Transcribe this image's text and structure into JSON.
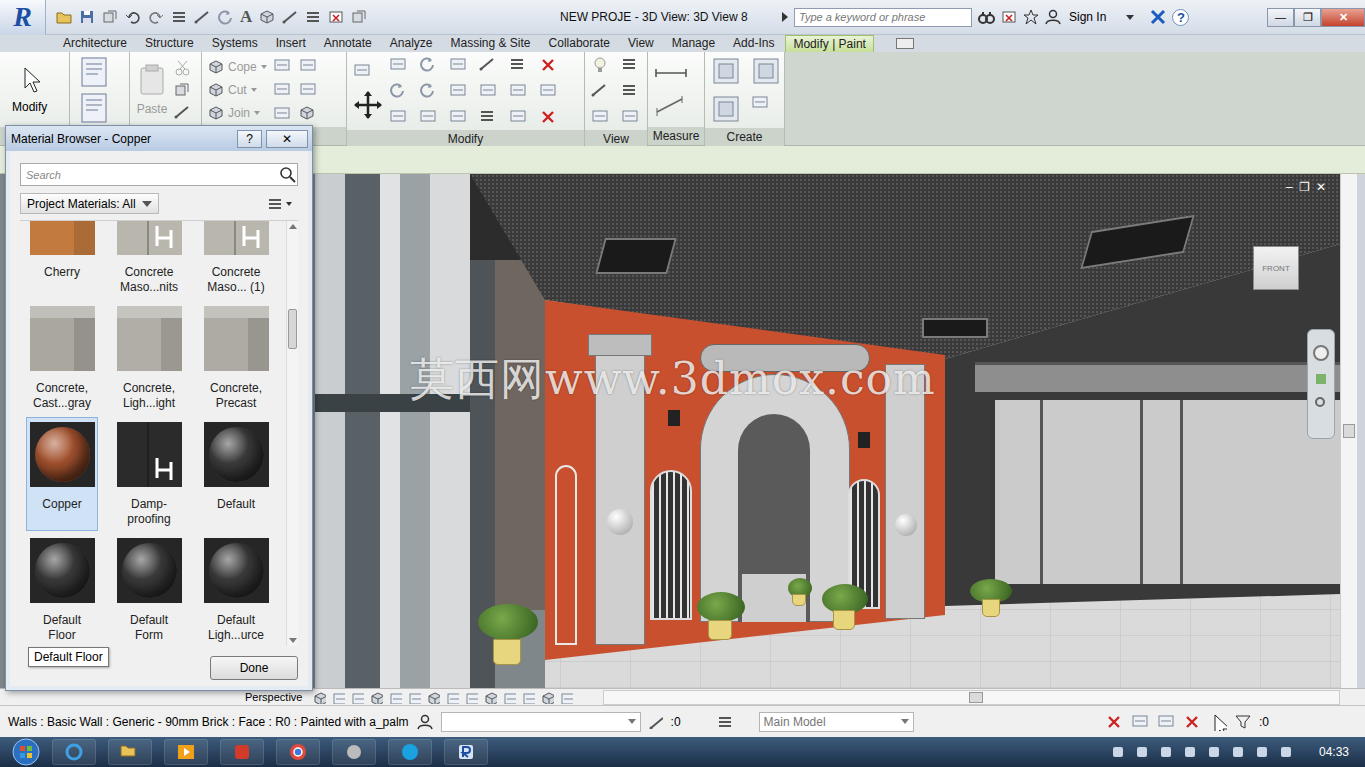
{
  "window": {
    "title": "NEW PROJE - 3D View: 3D View 8",
    "app_button": "R",
    "controls": [
      "—",
      "❐",
      "✕"
    ]
  },
  "quick_access": {
    "text_tool": "A"
  },
  "help_search": {
    "placeholder": "Type a keyword or phrase",
    "sign_in": "Sign In",
    "help": "?"
  },
  "ribbon_tabs": [
    {
      "label": "Architecture",
      "selected": false
    },
    {
      "label": "Structure",
      "selected": false
    },
    {
      "label": "Systems",
      "selected": false
    },
    {
      "label": "Insert",
      "selected": false
    },
    {
      "label": "Annotate",
      "selected": false
    },
    {
      "label": "Analyze",
      "selected": false
    },
    {
      "label": "Massing & Site",
      "selected": false
    },
    {
      "label": "Collaborate",
      "selected": false
    },
    {
      "label": "View",
      "selected": false
    },
    {
      "label": "Manage",
      "selected": false
    },
    {
      "label": "Add-Ins",
      "selected": false
    },
    {
      "label": "Modify | Paint",
      "selected": true
    }
  ],
  "ribbon": {
    "modify_button": "Modify",
    "paste": "Paste",
    "geometry": [
      {
        "label": "Cope",
        "disabled": true
      },
      {
        "label": "Cut",
        "disabled": true
      },
      {
        "label": "Join",
        "disabled": true
      }
    ],
    "panels": [
      {
        "label": "Modify"
      },
      {
        "label": "View"
      },
      {
        "label": "Measure"
      },
      {
        "label": "Create"
      }
    ]
  },
  "viewport": {
    "watermark": "莫西网www.3dmox.com",
    "viewcube_face": "FRONT",
    "controls": [
      "–",
      "❐",
      "✕"
    ]
  },
  "view_control_bar": {
    "scale": "Perspective"
  },
  "status_bar": {
    "message": "Walls : Basic Wall : Generic - 90mm Brick : Face : R0 : Painted with a_palm",
    "workset_count": ":0",
    "design_option": "Main Model",
    "selection_count": ":0"
  },
  "material_browser": {
    "title": "Material Browser - Copper",
    "help": "?",
    "close": "✕",
    "search_placeholder": "Search",
    "filter": "Project Materials: All",
    "materials": [
      {
        "name": "Cherry",
        "kind": "cube",
        "color": "#c27a3e",
        "selected": false
      },
      {
        "name": "Concrete Maso...nits",
        "kind": "scene",
        "color": "#b9b6ae",
        "selected": false
      },
      {
        "name": "Concrete Maso... (1)",
        "kind": "scene",
        "color": "#b9b6ae",
        "selected": false
      },
      {
        "name": "Concrete, Cast...gray",
        "kind": "cube",
        "color": "#a9a79e",
        "selected": false
      },
      {
        "name": "Concrete, Ligh...ight",
        "kind": "cube",
        "color": "#b0aea6",
        "selected": false
      },
      {
        "name": "Concrete, Precast",
        "kind": "cube",
        "color": "#adaba3",
        "selected": false
      },
      {
        "name": "Copper",
        "kind": "sphere",
        "color": "#a4522e",
        "selected": true
      },
      {
        "name": "Damp-proofing",
        "kind": "scene",
        "color": "#2b2b2b",
        "selected": false
      },
      {
        "name": "Default",
        "kind": "sphere",
        "color": "#3c3c3c",
        "selected": false
      },
      {
        "name": "Default Floor",
        "kind": "sphere",
        "color": "#3c3c3c",
        "selected": false
      },
      {
        "name": "Default Form",
        "kind": "sphere",
        "color": "#3c3c3c",
        "selected": false
      },
      {
        "name": "Default Ligh...urce",
        "kind": "sphere",
        "color": "#3c3c3c",
        "selected": false
      }
    ],
    "tooltip": "Default Floor",
    "done": "Done"
  },
  "taskbar": {
    "clock": "04:33"
  }
}
